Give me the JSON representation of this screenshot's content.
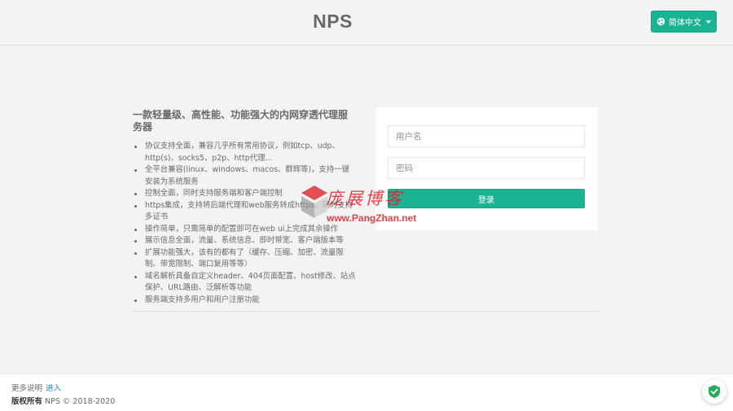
{
  "header": {
    "brand": "NPS",
    "language_label": "简体中文"
  },
  "intro": {
    "title": "一款轻量级、高性能、功能强大的内网穿透代理服务器",
    "features": [
      "协议支持全面，兼容几乎所有常用协议，例如tcp、udp、http(s)、socks5、p2p、http代理...",
      "全平台兼容(linux、windows、macos、群辉等)，支持一键安装为系统服务",
      "控制全面，同时支持服务端和客户端控制",
      "https集成，支持将后端代理和web服务转成https，同时支持多证书",
      "操作简单，只需简单的配置即可在web ui上完成其余操作",
      "展示信息全面，流量、系统信息、即时带宽、客户端版本等",
      "扩展功能强大，该有的都有了（缓存、压缩、加密、流量限制、带宽限制、端口复用等等）",
      "域名解析具备自定义header、404页面配置、host修改、站点保护、URL路由、泛解析等功能",
      "服务端支持多用户和用户注册功能"
    ]
  },
  "login": {
    "username_placeholder": "用户名",
    "password_placeholder": "密码",
    "submit_label": "登录"
  },
  "watermark": {
    "title": "庞展博客",
    "url": "www.PangZhan.net"
  },
  "footer": {
    "more_label": "更多说明",
    "more_link": "进入",
    "copyright_bold": "版权所有",
    "copyright_text": "NPS © 2018-2020"
  },
  "colors": {
    "accent": "#1ab394",
    "link": "#1c84c6",
    "background": "#f3f3f4",
    "watermark": "#d9252b"
  },
  "icons": {
    "language": "globe-icon",
    "dropdown": "caret-down-icon",
    "security": "shield-check-icon",
    "watermark_logo": "pangzhan-logo-icon"
  }
}
